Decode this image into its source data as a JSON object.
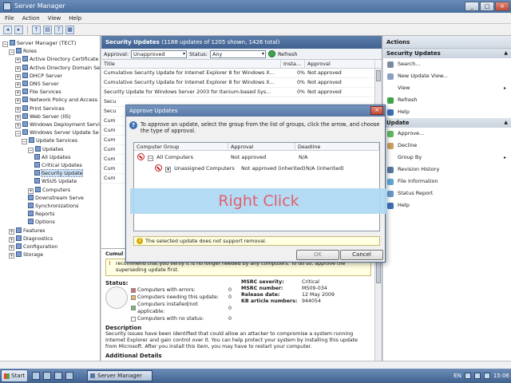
{
  "window": {
    "title": "Server Manager"
  },
  "menu": [
    "File",
    "Action",
    "View",
    "Help"
  ],
  "tree": [
    {
      "label": "Server Manager (TECT)",
      "level": 0
    },
    {
      "label": "Roles",
      "level": 1
    },
    {
      "label": "Active Directory Certificate",
      "level": 2
    },
    {
      "label": "Active Directory Domain Se",
      "level": 2
    },
    {
      "label": "DHCP Server",
      "level": 2
    },
    {
      "label": "DNS Server",
      "level": 2
    },
    {
      "label": "File Services",
      "level": 2
    },
    {
      "label": "Network Policy and Access",
      "level": 2
    },
    {
      "label": "Print Services",
      "level": 2
    },
    {
      "label": "Web Server (IIS)",
      "level": 2
    },
    {
      "label": "Windows Deployment Servi",
      "level": 2
    },
    {
      "label": "Windows Server Update Se",
      "level": 2
    },
    {
      "label": "Update Services",
      "level": 3
    },
    {
      "label": "Updates",
      "level": 4
    },
    {
      "label": "All Updates",
      "level": 5
    },
    {
      "label": "Critical Updates",
      "level": 5
    },
    {
      "label": "Security Update",
      "level": 5
    },
    {
      "label": "WSUS Update",
      "level": 5
    },
    {
      "label": "Computers",
      "level": 4
    },
    {
      "label": "Downstream Serve",
      "level": 4
    },
    {
      "label": "Synchronizations",
      "level": 4
    },
    {
      "label": "Reports",
      "level": 4
    },
    {
      "label": "Options",
      "level": 4
    },
    {
      "label": "Features",
      "level": 1
    },
    {
      "label": "Diagnostics",
      "level": 1
    },
    {
      "label": "Configuration",
      "level": 1
    },
    {
      "label": "Storage",
      "level": 1
    }
  ],
  "center": {
    "title": "Security Updates",
    "subtitle": "(1188 updates of 1205 shown, 1426 total)",
    "approval_label": "Approval:",
    "approval_value": "Unapproved",
    "status_label": "Status:",
    "status_value": "Any",
    "refresh_label": "Refresh",
    "columns": [
      "Title",
      "Insta...",
      "Approval"
    ],
    "rows": [
      {
        "title": "Cumulative Security Update for Internet Explorer 8 for Windows X...",
        "insta": "0%",
        "approval": "Not approved"
      },
      {
        "title": "Cumulative Security Update for Internet Explorer 8 for Windows X...",
        "insta": "0%",
        "approval": "Not approved"
      },
      {
        "title": "Security Update for Windows Server 2003 for Itanium-based Sys...",
        "insta": "0%",
        "approval": "Not approved"
      },
      {
        "title": "Secu",
        "insta": "",
        "approval": ""
      },
      {
        "title": "Secu",
        "insta": "",
        "approval": ""
      },
      {
        "title": "Cum",
        "insta": "",
        "approval": ""
      },
      {
        "title": "Cum",
        "insta": "",
        "approval": ""
      },
      {
        "title": "Cum",
        "insta": "",
        "approval": ""
      },
      {
        "title": "Cum",
        "insta": "",
        "approval": ""
      },
      {
        "title": "Cum",
        "insta": "",
        "approval": ""
      },
      {
        "title": "Cum",
        "insta": "",
        "approval": ""
      },
      {
        "title": "Cum",
        "insta": "",
        "approval": ""
      }
    ],
    "detail_header": "Cumul",
    "warn_text": "recommend that you verify it is no longer needed by any computers. To do so, approve the superseding update first.",
    "status_heading": "Status:",
    "legend": [
      {
        "label": "Computers with errors:",
        "value": "0",
        "color": "#d86b6b"
      },
      {
        "label": "Computers needing this update:",
        "value": "0",
        "color": "#e8b860"
      },
      {
        "label": "Computers installed/not applicable:",
        "value": "0",
        "color": "#78b878"
      },
      {
        "label": "Computers with no status:",
        "value": "0",
        "color": "#ffffff"
      }
    ],
    "kv": [
      {
        "k": "MSRC severity:",
        "v": "Critical"
      },
      {
        "k": "MSRC number:",
        "v": "MS09-034"
      },
      {
        "k": "Release date:",
        "v": "12 May 2009"
      },
      {
        "k": "KB article numbers:",
        "v": "944054"
      }
    ],
    "description_heading": "Description",
    "description": "Security issues have been identified that could allow an attacker to compromise a system running Internet Explorer and gain control over it. You can help protect your system by installing this update from Microsoft. After you install this item, you may have to restart your computer.",
    "additional_heading": "Additional Details"
  },
  "actions": {
    "title": "Actions",
    "sec1": "Security Updates",
    "items1": [
      {
        "label": "Search...",
        "icon": "search-icon",
        "color": "#7a8aa0",
        "sub": false
      },
      {
        "label": "New Update View...",
        "icon": "new-view-icon",
        "color": "#8aa0c0",
        "sub": false
      },
      {
        "label": "View",
        "icon": "view-icon",
        "color": "#ffffff",
        "sub": true
      },
      {
        "label": "Refresh",
        "icon": "refresh-icon",
        "color": "#3fa44a",
        "sub": false
      },
      {
        "label": "Help",
        "icon": "help-icon",
        "color": "#3c6fb4",
        "sub": false
      }
    ],
    "sec2": "Update",
    "items2": [
      {
        "label": "Approve...",
        "icon": "approve-icon",
        "color": "#5fb860",
        "sub": false
      },
      {
        "label": "Decline",
        "icon": "decline-icon",
        "color": "#c8a060",
        "sub": false
      },
      {
        "label": "Group By",
        "icon": "group-icon",
        "color": "#ffffff",
        "sub": true
      },
      {
        "label": "Revision History",
        "icon": "history-icon",
        "color": "#5677a5",
        "sub": false
      },
      {
        "label": "File Information",
        "icon": "file-info-icon",
        "color": "#5fa8d8",
        "sub": false
      },
      {
        "label": "Status Report",
        "icon": "report-icon",
        "color": "#6898c8",
        "sub": false
      },
      {
        "label": "Help",
        "icon": "help-icon",
        "color": "#3c6fb4",
        "sub": false
      }
    ]
  },
  "dialog": {
    "title": "Approve Updates",
    "intro": "To approve an update, select the group from the list of groups, click the arrow, and choose the type of approval.",
    "columns": [
      "Computer Group",
      "Approval",
      "Deadline"
    ],
    "groups": [
      {
        "name": "All Computers",
        "approval": "Not approved",
        "deadline": "N/A"
      },
      {
        "name": "Unassigned Computers",
        "approval": "Not approved (inherited)",
        "deadline": "N/A (inherited)"
      }
    ],
    "status": "The selected update does not support removal.",
    "ok": "OK",
    "cancel": "Cancel"
  },
  "overlay": {
    "text": "Right Click"
  },
  "taskbar": {
    "start": "Start",
    "item": "Server Manager",
    "lang": "EN",
    "time": "15:06"
  }
}
